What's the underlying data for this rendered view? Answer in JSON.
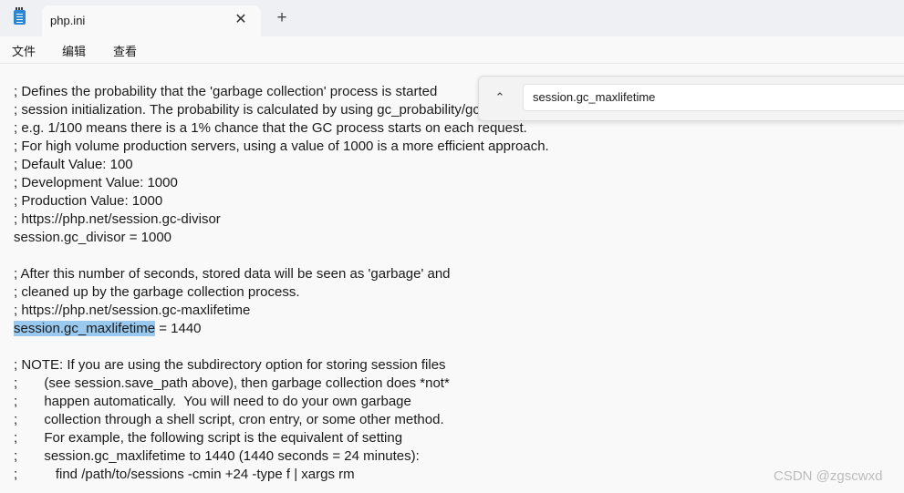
{
  "tab": {
    "title": "php.ini",
    "close_glyph": "✕",
    "new_tab_glyph": "+"
  },
  "icons": {
    "app": "notepad-icon",
    "tab_close": "close-icon",
    "new_tab": "plus-icon",
    "find_toggle": "chevron-up-icon"
  },
  "menu": {
    "file": "文件",
    "edit": "编辑",
    "view": "查看"
  },
  "find": {
    "toggle_glyph": "⌃",
    "query": "session.gc_maxlifetime"
  },
  "editor": {
    "lines": [
      "; Defines the probability that the 'garbage collection' process is started",
      "; session initialization. The probability is calculated by using gc_probability/gc_divisor.",
      "; e.g. 1/100 means there is a 1% chance that the GC process starts on each request.",
      "; For high volume production servers, using a value of 1000 is a more efficient approach.",
      "; Default Value: 100",
      "; Development Value: 1000",
      "; Production Value: 1000",
      "; https://php.net/session.gc-divisor",
      "session.gc_divisor = 1000",
      "",
      "; After this number of seconds, stored data will be seen as 'garbage' and",
      "; cleaned up by the garbage collection process.",
      "; https://php.net/session.gc-maxlifetime",
      "",
      "",
      "; NOTE: If you are using the subdirectory option for storing session files",
      ";       (see session.save_path above), then garbage collection does *not*",
      ";       happen automatically.  You will need to do your own garbage",
      ";       collection through a shell script, cron entry, or some other method.",
      ";       For example, the following script is the equivalent of setting",
      ";       session.gc_maxlifetime to 1440 (1440 seconds = 24 minutes):",
      ";          find /path/to/sessions -cmin +24 -type f | xargs rm"
    ],
    "highlight_line": {
      "selected_text": "session.gc_maxlifetime",
      "rest": " = 1440"
    }
  },
  "watermark": "CSDN @zgscwxd",
  "colors": {
    "selection": "#99c9ef",
    "tabbar": "#eef0f4",
    "background": "#f9f9f9"
  }
}
